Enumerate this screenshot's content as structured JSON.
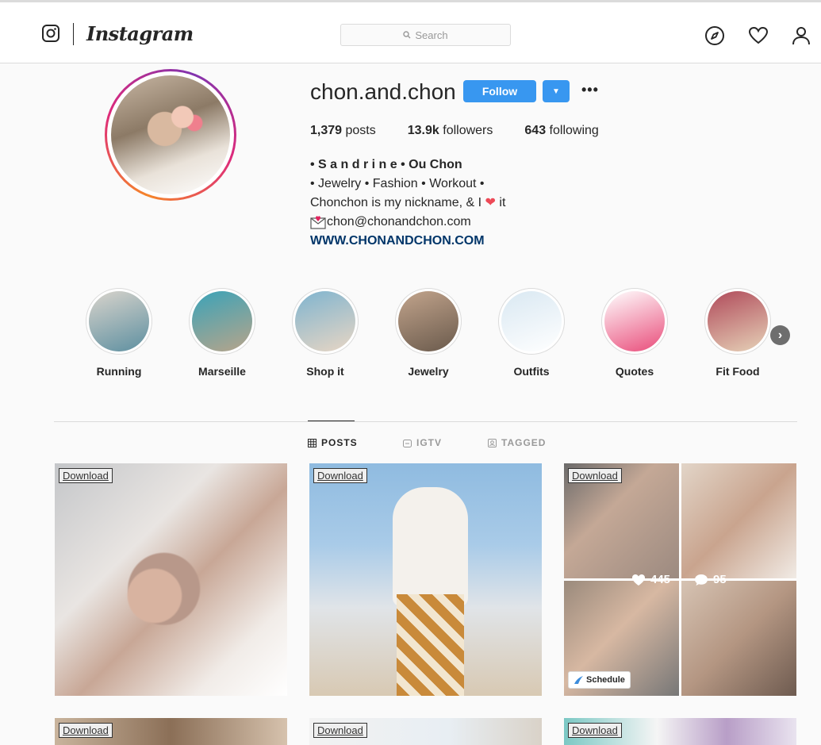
{
  "topbar": {
    "brand": "Instagram",
    "search_placeholder": "Search",
    "icons": [
      "instagram-camera-icon",
      "explore-compass-icon",
      "activity-heart-icon",
      "profile-person-icon",
      "search-icon"
    ]
  },
  "profile": {
    "username": "chon.and.chon",
    "follow_label": "Follow",
    "dropdown_icon": "caret-down-icon",
    "more_icon": "more-options-icon",
    "stats": {
      "posts_count": "1,379",
      "posts_label": "posts",
      "followers_count": "13.9k",
      "followers_label": "followers",
      "following_count": "643",
      "following_label": "following"
    },
    "bio": {
      "name": "• S a n d r i n e • Ou Chon",
      "line1": "• Jewelry • Fashion • Workout •",
      "line2_before": "Chonchon is my nickname, & I ",
      "line2_heart": "❤",
      "line2_after": " it",
      "email": "chon@chonandchon.com",
      "website": "WWW.CHONANDCHON.COM"
    }
  },
  "highlights": [
    {
      "label": "Running",
      "color_a": "#d9d4cc",
      "color_b": "#5d8fa0"
    },
    {
      "label": "Marseille",
      "color_a": "#3aa3b8",
      "color_b": "#b8a48a"
    },
    {
      "label": "Shop it",
      "color_a": "#7fb4cf",
      "color_b": "#e8d6c4"
    },
    {
      "label": "Jewelry",
      "color_a": "#c2a48c",
      "color_b": "#6a5a4c"
    },
    {
      "label": "Outfits",
      "color_a": "#d9e8f2",
      "color_b": "#ffffff"
    },
    {
      "label": "Quotes",
      "color_a": "#ffffff",
      "color_b": "#e94c7a"
    },
    {
      "label": "Fit Food",
      "color_a": "#b04a5a",
      "color_b": "#e6d2b8"
    }
  ],
  "highlights_next_icon": "chevron-right-icon",
  "tabs": [
    {
      "label": "POSTS",
      "icon": "grid-icon",
      "active": true
    },
    {
      "label": "IGTV",
      "icon": "igtv-icon",
      "active": false
    },
    {
      "label": "TAGGED",
      "icon": "tagged-icon",
      "active": false
    }
  ],
  "posts": [
    {
      "badge": "Download"
    },
    {
      "badge": "Download"
    },
    {
      "badge": "Download",
      "likes": "445",
      "comments": "95",
      "schedule": "Schedule"
    },
    {
      "badge": "Download"
    },
    {
      "badge": "Download"
    },
    {
      "badge": "Download"
    }
  ]
}
